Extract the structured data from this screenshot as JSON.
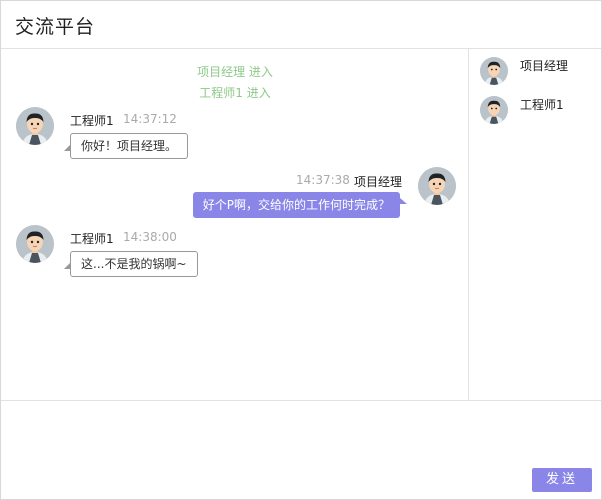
{
  "window": {
    "title": "交流平台"
  },
  "chat": {
    "system_messages": [
      "项目经理 进入",
      "工程师1 进入"
    ],
    "messages": [
      {
        "sender": "工程师1",
        "time": "14:37:12",
        "text": "你好！项目经理。",
        "side": "left"
      },
      {
        "sender": "项目经理",
        "time": "14:37:38",
        "text": "好个P啊，交给你的工作何时完成？",
        "side": "right"
      },
      {
        "sender": "工程师1",
        "time": "14:38:00",
        "text": "这...不是我的锅啊~",
        "side": "left"
      }
    ]
  },
  "members": [
    "项目经理",
    "工程师1"
  ],
  "input": {
    "value": "",
    "send_label": "发送"
  },
  "colors": {
    "accent": "#8a86e8",
    "system_text": "#8ec98a"
  },
  "icons": {
    "avatar": "avatar-icon"
  }
}
